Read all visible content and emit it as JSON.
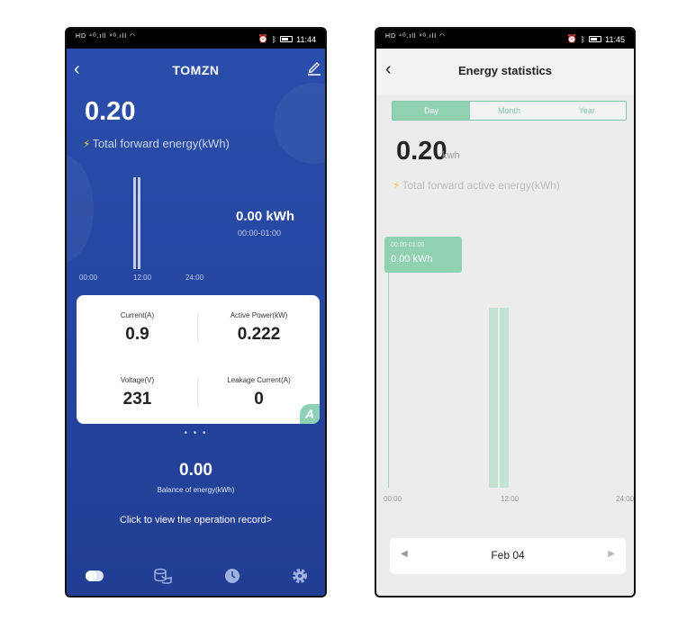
{
  "phone1": {
    "status": {
      "time": "11:44"
    },
    "header": {
      "title": "TOMZN"
    },
    "energy": {
      "value": "0.20",
      "label": "Total forward energy(kWh)"
    },
    "chart": {
      "value_label": "0.00 kWh",
      "time_label": "00:00-01:00",
      "ticks": [
        "00:00",
        "12:00",
        "24:00"
      ]
    },
    "metrics": [
      {
        "label": "Current(A)",
        "value": "0.9"
      },
      {
        "label": "Active Power(kW)",
        "value": "0.222"
      },
      {
        "label": "Voltage(V)",
        "value": "231"
      },
      {
        "label": "Leakage Current(A)",
        "value": "0"
      }
    ],
    "card_badge": "A",
    "pager_dots": "• • •",
    "balance": {
      "value": "0.00",
      "label": "Balance of energy(kWh)"
    },
    "record_link": "Click to view the operation record>"
  },
  "phone2": {
    "status": {
      "time": "11:45"
    },
    "header": {
      "title": "Energy statistics"
    },
    "tabs": [
      "Day",
      "Month",
      "Year"
    ],
    "energy": {
      "value": "0.20",
      "unit": "kwh",
      "label": "Total forward active energy(kWh)"
    },
    "tooltip": {
      "time": "00:00-01:00",
      "value": "0.00 kWh"
    },
    "ticks": [
      "00:00",
      "12:00",
      "24:00"
    ],
    "date": "Feb 04"
  }
}
